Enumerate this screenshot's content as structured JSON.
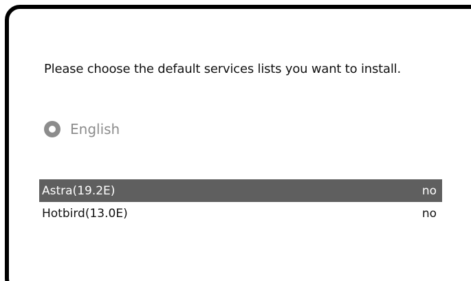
{
  "dialog": {
    "prompt": "Please choose the default services lists you want to install."
  },
  "region_option": {
    "label": "English",
    "icon": "radio-icon"
  },
  "services": [
    {
      "name": "Astra(19.2E)",
      "value": "no",
      "selected": true
    },
    {
      "name": "Hotbird(13.0E)",
      "value": "no",
      "selected": false
    }
  ],
  "colors": {
    "selection": "#5f5f5f",
    "disabled_text": "#8c8c8c"
  }
}
